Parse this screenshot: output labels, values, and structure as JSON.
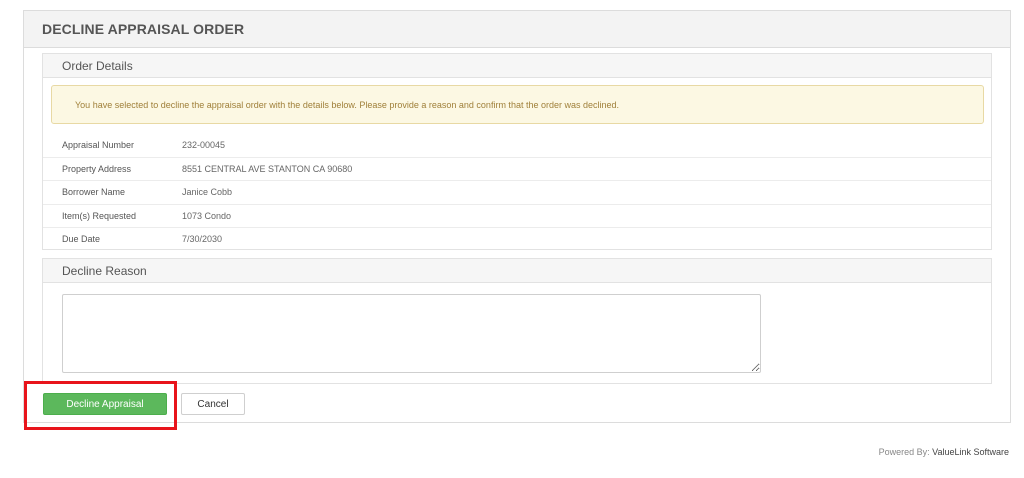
{
  "panel": {
    "title": "DECLINE APPRAISAL ORDER"
  },
  "order_details": {
    "title": "Order Details",
    "alert": "You have selected to decline the appraisal order with the details below. Please provide a reason and confirm that the order was declined.",
    "rows": [
      {
        "label": "Appraisal Number",
        "value": "232-00045"
      },
      {
        "label": "Property Address",
        "value": "8551 CENTRAL AVE STANTON CA 90680"
      },
      {
        "label": "Borrower Name",
        "value": "Janice Cobb"
      },
      {
        "label": "Item(s) Requested",
        "value": "1073 Condo"
      },
      {
        "label": "Due Date",
        "value": "7/30/2030"
      }
    ]
  },
  "decline_reason": {
    "title": "Decline Reason",
    "value": "",
    "placeholder": ""
  },
  "actions": {
    "decline_label": "Decline Appraisal",
    "cancel_label": "Cancel"
  },
  "footer": {
    "prefix": "Powered By: ",
    "brand": "ValueLink Software"
  },
  "colors": {
    "primary_button": "#5cb85c",
    "alert_background": "#fcf8e3",
    "highlight_border": "#e8141b"
  }
}
